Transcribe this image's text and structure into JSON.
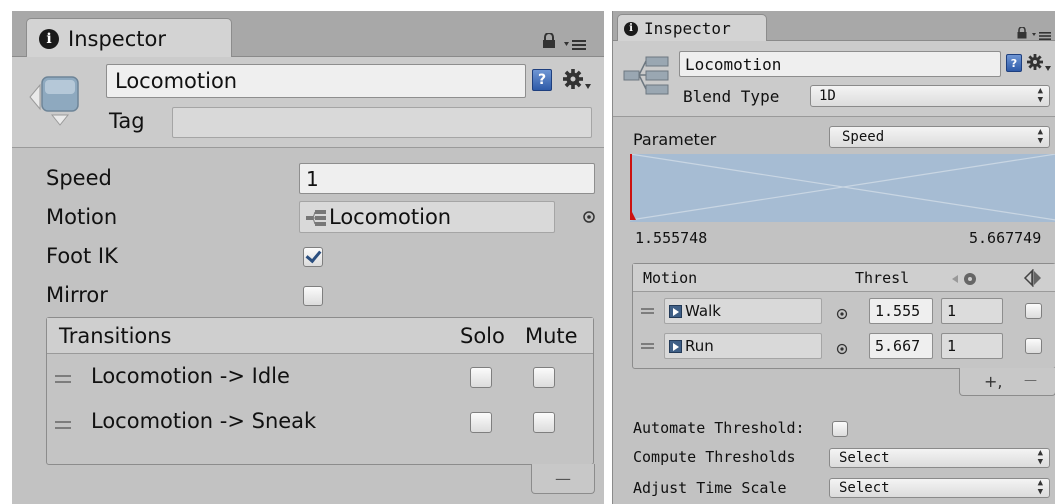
{
  "left_inspector": {
    "tab_title": "Inspector",
    "object_name": "Locomotion",
    "tag_label": "Tag",
    "tag_value": "",
    "help_glyph": "?",
    "icons": [
      "lock-icon",
      "panel-menu-icon",
      "state-node-icon",
      "gear-icon"
    ],
    "properties": [
      {
        "label": "Speed",
        "value": "1"
      },
      {
        "label": "Motion",
        "value": "Locomotion"
      },
      {
        "label": "Foot IK",
        "checked": true
      },
      {
        "label": "Mirror",
        "checked": false
      }
    ],
    "transitions": {
      "header": "Transitions",
      "solo_label": "Solo",
      "mute_label": "Mute",
      "rows": [
        {
          "label": "Locomotion -> Idle",
          "solo": false,
          "mute": false
        },
        {
          "label": "Locomotion -> Sneak",
          "solo": false,
          "mute": false
        }
      ],
      "remove_label": "—"
    }
  },
  "right_inspector": {
    "tab_title": "Inspector",
    "object_name": "Locomotion",
    "blend_type_label": "Blend Type",
    "blend_type_value": "1D",
    "help_glyph": "?",
    "icons": [
      "lock-icon",
      "panel-menu-icon",
      "blend-tree-icon",
      "gear-icon"
    ],
    "parameter_label": "Parameter",
    "parameter_value": "Speed",
    "range_min": "1.555748",
    "range_max": "5.667749",
    "motion_table": {
      "col_motion": "Motion",
      "col_threshold": "Thresl",
      "rows": [
        {
          "name": "Walk",
          "threshold": "1.555",
          "speed": "1",
          "mirror": false
        },
        {
          "name": "Run",
          "threshold": "5.667",
          "speed": "1",
          "mirror": false
        }
      ],
      "add_label": "+,",
      "remove_label": "—"
    },
    "automate_threshold_label": "Automate Threshold:",
    "automate_threshold_checked": false,
    "compute_thresholds_label": "Compute Thresholds",
    "compute_thresholds_value": "Select",
    "adjust_time_scale_label": "Adjust Time Scale",
    "adjust_time_scale_value": "Select"
  },
  "colors": {
    "panel_bg": "#c2c2c2",
    "header_bg": "#cbcbcb",
    "graph_fill": "#a6bcd3",
    "graph_marker": "#cc1111",
    "help_blue": "#2e5aa8"
  }
}
